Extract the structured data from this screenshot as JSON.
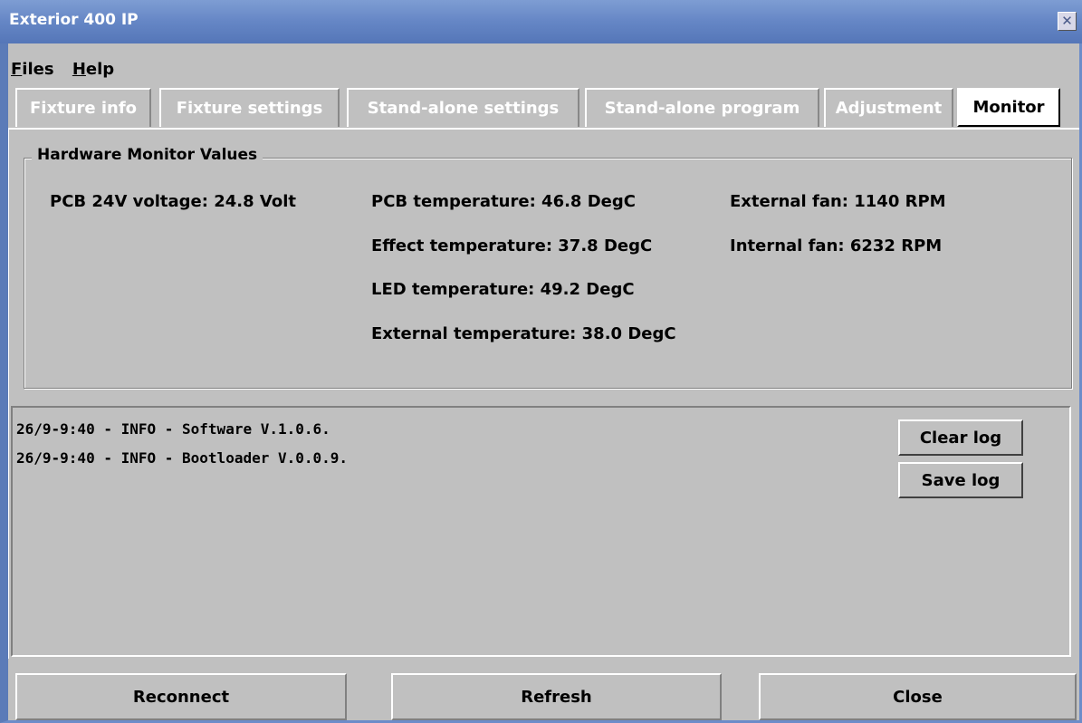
{
  "window": {
    "title": "Exterior 400 IP",
    "close_glyph": "✕"
  },
  "menu": [
    {
      "underline": "F",
      "rest": "iles"
    },
    {
      "underline": "H",
      "rest": "elp"
    }
  ],
  "tabs": [
    {
      "label": "Fixture info",
      "active": false
    },
    {
      "label": "Fixture settings",
      "active": false
    },
    {
      "label": "Stand-alone settings",
      "active": false
    },
    {
      "label": "Stand-alone program",
      "active": false
    },
    {
      "label": "Adjustment",
      "active": false
    },
    {
      "label": "Monitor",
      "active": true
    }
  ],
  "monitor": {
    "group_title": "Hardware Monitor Values",
    "pcb_voltage": "PCB 24V voltage: 24.8 Volt",
    "pcb_temp": "PCB temperature: 46.8 DegC",
    "effect_temp": "Effect temperature: 37.8 DegC",
    "led_temp": "LED temperature: 49.2 DegC",
    "external_temp": "External temperature: 38.0 DegC",
    "external_fan": "External fan: 1140 RPM",
    "internal_fan": "Internal fan: 6232 RPM"
  },
  "log": {
    "lines": [
      "26/9-9:40 - INFO - Software V.1.0.6.",
      "26/9-9:40 - INFO - Bootloader V.0.0.9."
    ],
    "clear_label": "Clear log",
    "save_label": "Save log"
  },
  "footer": {
    "reconnect_label": "Reconnect",
    "refresh_label": "Refresh",
    "close_label": "Close"
  }
}
